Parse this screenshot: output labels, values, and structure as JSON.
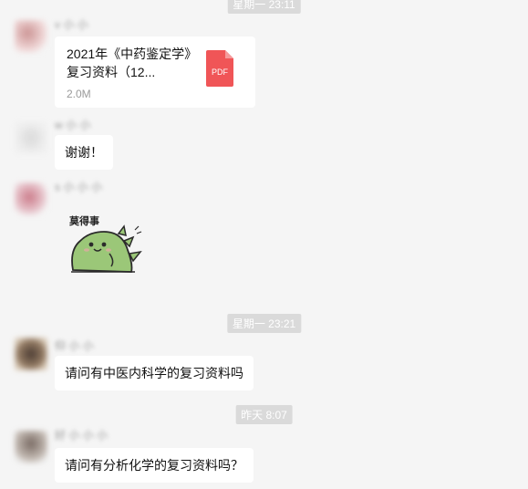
{
  "timestamps": [
    "星期一 23:11",
    "星期一 23:21",
    "昨天 8:07"
  ],
  "messages": {
    "m1": {
      "sender_name": "v 小 小",
      "file_name": "2021年《中药鉴定学》复习资料（12...",
      "file_size": "2.0M",
      "file_type": "PDF"
    },
    "m2": {
      "sender_name": "w 小 小",
      "text": "谢谢！"
    },
    "m3": {
      "sender_name": "s 小 小 小",
      "sticker_caption": "莫得事",
      "sticker_icon": "dinosaur-sticker"
    },
    "m4": {
      "sender_name": "仰 小 小",
      "text": "请问有中医内科学的复习资料吗"
    },
    "m5": {
      "sender_name": "好 小 小 小",
      "text": "请问有分析化学的复习资料吗？"
    }
  },
  "colors": {
    "background": "#f5f5f5",
    "bubble": "#ffffff",
    "pdf_red": "#f05557",
    "timestamp_bg": "#dadada",
    "sticker_green": "#9bc778"
  }
}
